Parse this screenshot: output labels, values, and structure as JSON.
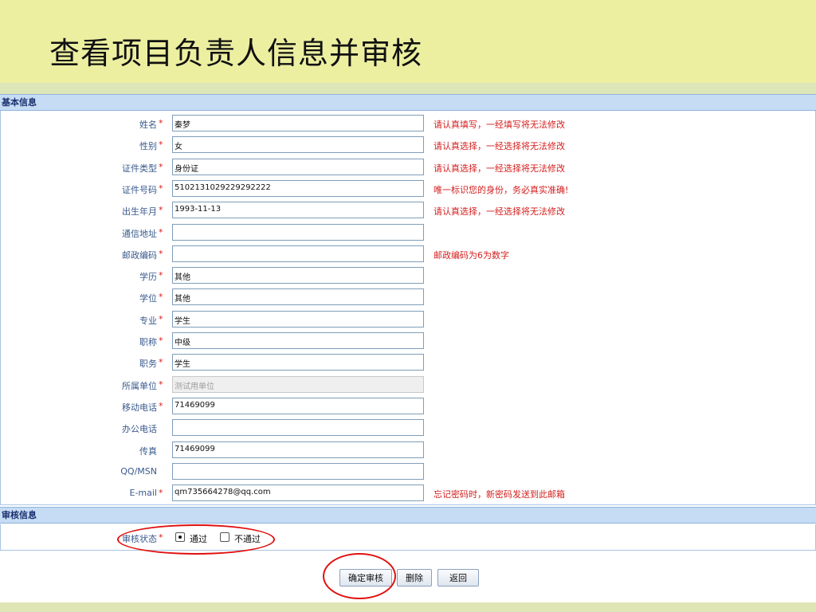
{
  "slide": {
    "title": "查看项目负责人信息并审核"
  },
  "basic_section": {
    "title": "基本信息"
  },
  "fields": [
    {
      "label": "姓名",
      "required": "*",
      "value": "秦梦",
      "hint": "请认真填写，一经填写将无法修改"
    },
    {
      "label": "性别",
      "required": "*",
      "value": "女",
      "hint": "请认真选择，一经选择将无法修改"
    },
    {
      "label": "证件类型",
      "required": "*",
      "value": "身份证",
      "hint": "请认真选择，一经选择将无法修改"
    },
    {
      "label": "证件号码",
      "required": "*",
      "value": "5102131029229292222",
      "hint": "唯一标识您的身份，务必真实准确!"
    },
    {
      "label": "出生年月",
      "required": "*",
      "value": "1993-11-13",
      "hint": "请认真选择，一经选择将无法修改"
    },
    {
      "label": "通信地址",
      "required": "*",
      "value": "",
      "hint": ""
    },
    {
      "label": "邮政编码",
      "required": "*",
      "value": "",
      "hint": "邮政编码为6为数字"
    },
    {
      "label": "学历",
      "required": "*",
      "value": "其他",
      "hint": ""
    },
    {
      "label": "学位",
      "required": "*",
      "value": "其他",
      "hint": ""
    },
    {
      "label": "专业",
      "required": "*",
      "value": "学生",
      "hint": ""
    },
    {
      "label": "职称",
      "required": "*",
      "value": "中级",
      "hint": ""
    },
    {
      "label": "职务",
      "required": "*",
      "value": "学生",
      "hint": ""
    },
    {
      "label": "所属单位",
      "required": "*",
      "value": "测试用单位",
      "hint": "",
      "disabled": true
    },
    {
      "label": "移动电话",
      "required": "*",
      "value": "71469099",
      "hint": ""
    },
    {
      "label": "办公电话",
      "required": "",
      "value": "",
      "hint": ""
    },
    {
      "label": "传真",
      "required": "",
      "value": "71469099",
      "hint": ""
    },
    {
      "label": "QQ/MSN",
      "required": "",
      "value": "",
      "hint": ""
    },
    {
      "label": "E-mail",
      "required": "*",
      "value": "qm735664278@qq.com",
      "hint": "忘记密码时，新密码发送到此邮箱"
    }
  ],
  "audit_section": {
    "title": "审核信息",
    "status_label": "审核状态",
    "required": "*",
    "options": [
      {
        "label": "通过",
        "checked": true
      },
      {
        "label": "不通过",
        "checked": false
      }
    ]
  },
  "buttons": {
    "confirm": "确定审核",
    "delete": "删除",
    "back": "返回"
  },
  "colors": {
    "annotation": "#e01010",
    "section_bar": "#c6dcf4",
    "slide_background": "#ecefa0"
  }
}
